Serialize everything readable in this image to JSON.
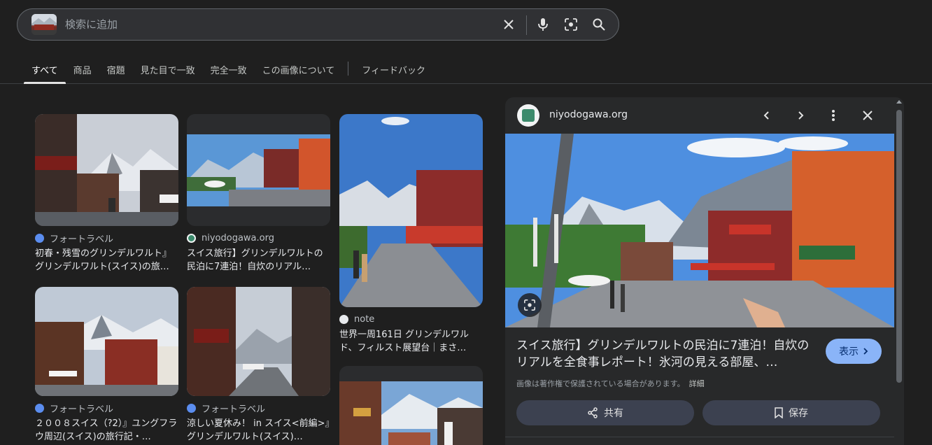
{
  "search": {
    "placeholder": "検索に追加",
    "icons": [
      "close-icon",
      "mic-icon",
      "lens-icon",
      "search-icon"
    ]
  },
  "tabs": [
    {
      "label": "すべて",
      "active": true
    },
    {
      "label": "商品"
    },
    {
      "label": "宿題"
    },
    {
      "label": "見た目で一致"
    },
    {
      "label": "完全一致"
    },
    {
      "label": "この画像について"
    },
    {
      "label": "フィードバック"
    }
  ],
  "results": [
    {
      "source": "フォートラベル",
      "title": "初春・残雪のグリンデルワルト』グリンデルワルト(スイス)の旅…"
    },
    {
      "source": "niyodogawa.org",
      "title": "スイス旅行】グリンデルワルトの民泊に7連泊！自炊のリアル…"
    },
    {
      "source": "note",
      "title": "世界一周161日 グリンデルワルド、フィルスト展望台｜まさ…"
    },
    {
      "source": "フォートラベル",
      "title": "２００８スイス（?2）』ユングフラウ周辺(スイス)の旅行記・…"
    },
    {
      "source": "フォートラベル",
      "title": "涼しい夏休み！ in スイス<前編>』グリンデルワルト(スイス)…"
    }
  ],
  "panel": {
    "domain": "niyodogawa.org",
    "title": "スイス旅行】グリンデルワルトの民泊に7連泊！自炊のリアルを全食事レポート！氷河の見える部屋、…",
    "visit_label": "表示",
    "copyright": "画像は著作権で保護されている場合があります。",
    "details_label": "詳細",
    "share_label": "共有",
    "save_label": "保存"
  },
  "colors": {
    "background": "#1f1f1f",
    "panel": "#28292a",
    "accent": "#8ab4f8"
  }
}
